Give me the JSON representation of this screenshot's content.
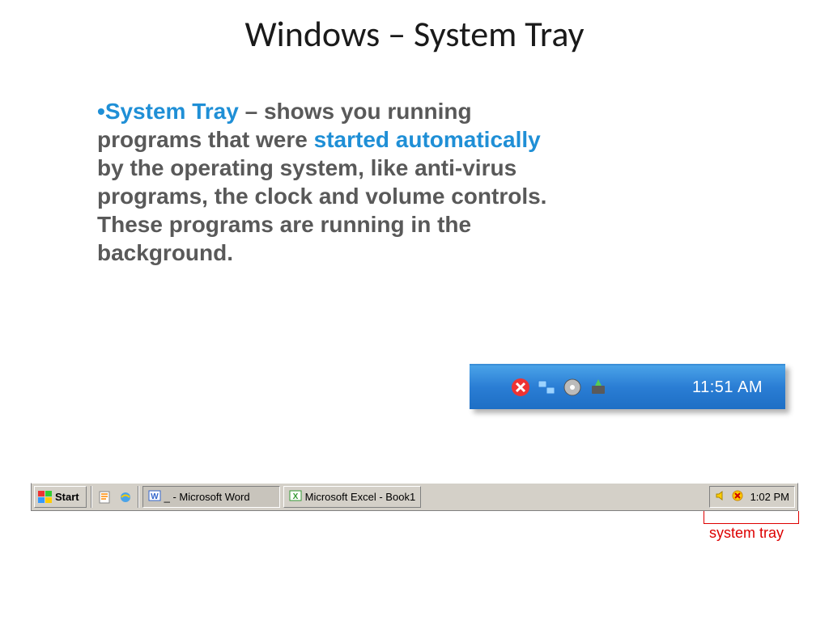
{
  "title": "Windows – System Tray",
  "body": {
    "term": "System Tray",
    "part1": " – shows you running programs that were ",
    "highlight": "started automatically",
    "part2": " by the operating system, like anti-virus programs, the clock and volume controls. These programs are running in the background."
  },
  "xp_tray": {
    "time": "11:51 AM",
    "icons": [
      "security-alert-icon",
      "network-icon",
      "disc-icon",
      "device-icon"
    ]
  },
  "classic_taskbar": {
    "start": "Start",
    "quicklaunch": [
      "notepad-icon",
      "ie-icon"
    ],
    "tasks": [
      {
        "icon": "word-icon",
        "label": "_ - Microsoft Word",
        "active": true
      },
      {
        "icon": "excel-icon",
        "label": "Microsoft Excel - Book1",
        "active": false
      }
    ],
    "tray_icons": [
      "volume-icon",
      "shield-icon"
    ],
    "time": "1:02 PM"
  },
  "annotation": "system tray"
}
